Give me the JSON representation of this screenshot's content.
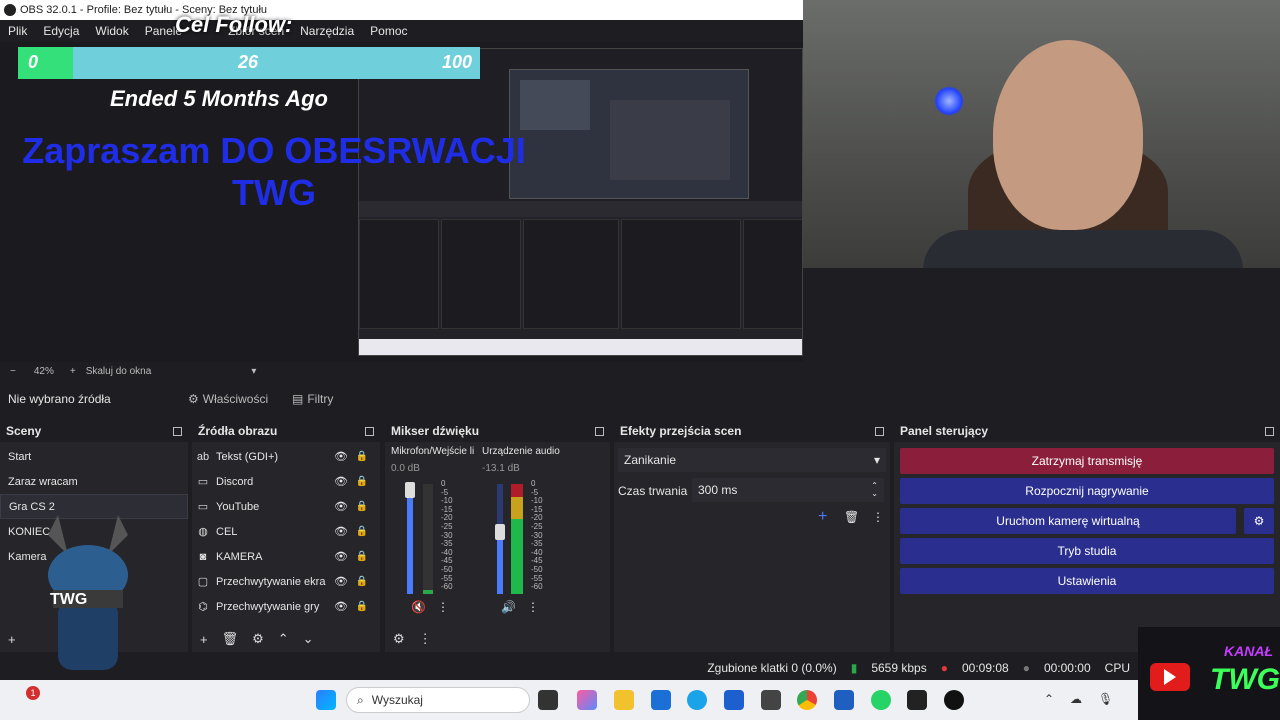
{
  "window": {
    "title": "OBS 32.0.1 - Profile: Bez tytułu - Sceny: Bez tytułu"
  },
  "menu": [
    "Plik",
    "Edycja",
    "Widok",
    "Panele",
    "Zbiór scen",
    "Narzędzia",
    "Pomoc"
  ],
  "preview": {
    "goal_title": "Cel Follow:",
    "goal_min": "0",
    "goal_current": "26",
    "goal_max": "100",
    "goal_fraction": 0.26,
    "ended": "Ended 5 Months Ago",
    "invite_line1": "Zapraszam DO OBESRWACJI",
    "invite_line2": "TWG"
  },
  "zoom": {
    "minus": "−",
    "value": "42%",
    "plus": "+",
    "mode": "Skaluj do okna"
  },
  "source_bar": {
    "none_selected": "Nie wybrano źródła",
    "properties": "Właściwości",
    "filters": "Filtry"
  },
  "scenes": {
    "title": "Sceny",
    "items": [
      "Start",
      "Zaraz wracam",
      "Gra CS 2",
      "KONIEC",
      "Kamera"
    ],
    "selected_index": 2
  },
  "sources": {
    "title": "Źródła obrazu",
    "items": [
      {
        "name": "Tekst (GDI+)",
        "icon": "text-icon"
      },
      {
        "name": "Discord",
        "icon": "monitor-icon"
      },
      {
        "name": "YouTube",
        "icon": "monitor-icon"
      },
      {
        "name": "CEL",
        "icon": "globe-icon"
      },
      {
        "name": "KAMERA",
        "icon": "camera-icon"
      },
      {
        "name": "Przechwytywanie ekra",
        "icon": "display-icon"
      },
      {
        "name": "Przechwytywanie gry",
        "icon": "gamepad-icon"
      }
    ]
  },
  "mixer": {
    "title": "Mikser dźwięku",
    "channels": [
      {
        "name": "Mikrofon/Wejście li",
        "db": "0.0 dB",
        "muted": true,
        "level": 0.95
      },
      {
        "name": "Urządzenie audio",
        "db": "-13.1 dB",
        "muted": false,
        "level": 0.6
      }
    ],
    "scale": [
      "0",
      "-5",
      "-10",
      "-15",
      "-20",
      "-25",
      "-30",
      "-35",
      "-40",
      "-45",
      "-50",
      "-55",
      "-60"
    ]
  },
  "transitions": {
    "title": "Efekty przejścia scen",
    "selected": "Zanikanie",
    "duration_label": "Czas trwania",
    "duration_value": "300 ms"
  },
  "controls": {
    "title": "Panel sterujący",
    "stop_stream": "Zatrzymaj transmisję",
    "start_recording": "Rozpocznij nagrywanie",
    "virtual_cam": "Uruchom kamerę wirtualną",
    "studio_mode": "Tryb studia",
    "settings": "Ustawienia"
  },
  "status": {
    "dropped": "Zgubione klatki 0 (0.0%)",
    "bitrate": "5659 kbps",
    "stream_time": "00:09:08",
    "rec_time": "00:00:00",
    "cpu": "CPU"
  },
  "taskbar": {
    "search_placeholder": "Wyszukaj",
    "notification_count": "1"
  },
  "overlay": {
    "brand_line1": "KANAŁ",
    "brand_line2": "TWG",
    "mascot_label": "TWG"
  },
  "colors": {
    "stop_stream": "#8b1f3b",
    "button_blue": "#2a2f8f",
    "invite": "#1f2ee6",
    "goal_fill": "#33e07a",
    "goal_bg": "#6fd0dc"
  }
}
